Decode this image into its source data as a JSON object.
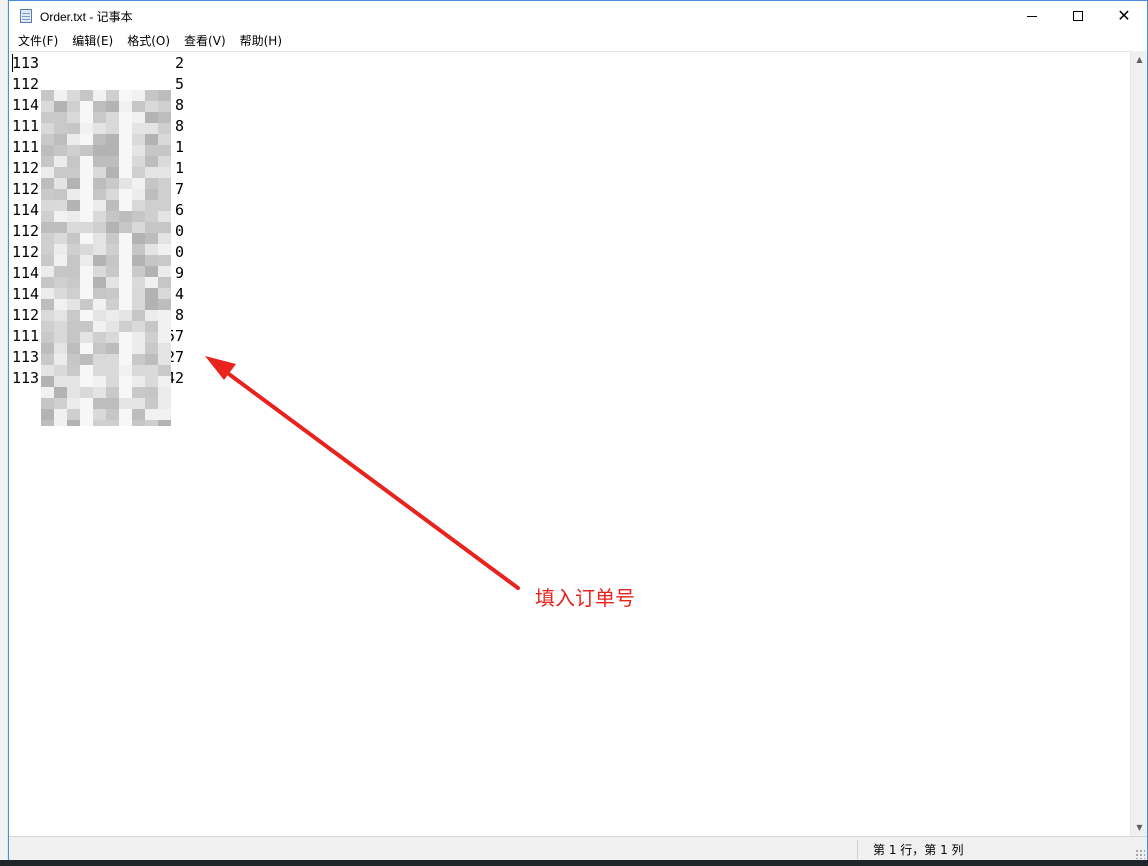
{
  "window": {
    "title": "Order.txt - 记事本",
    "controls": {
      "minimize": "minimize-icon",
      "maximize": "maximize-icon",
      "close": "✕"
    }
  },
  "menu": [
    {
      "label": "文件(F)"
    },
    {
      "label": "编辑(E)"
    },
    {
      "label": "格式(O)"
    },
    {
      "label": "查看(V)"
    },
    {
      "label": "帮助(H)"
    }
  ],
  "editor": {
    "lines": [
      {
        "visible_prefix": "113",
        "visible_suffix": "2"
      },
      {
        "visible_prefix": "112",
        "visible_suffix": "5"
      },
      {
        "visible_prefix": "114",
        "visible_suffix": "8"
      },
      {
        "visible_prefix": "111",
        "visible_suffix": "8"
      },
      {
        "visible_prefix": "111",
        "visible_suffix": "1"
      },
      {
        "visible_prefix": "112",
        "visible_suffix": "1"
      },
      {
        "visible_prefix": "112",
        "visible_suffix": "7"
      },
      {
        "visible_prefix": "114",
        "visible_suffix": "6"
      },
      {
        "visible_prefix": "112",
        "visible_suffix": "0"
      },
      {
        "visible_prefix": "112",
        "visible_suffix": "0"
      },
      {
        "visible_prefix": "114",
        "visible_suffix": "9"
      },
      {
        "visible_prefix": "114-",
        "visible_suffix": "4"
      },
      {
        "visible_prefix": "112",
        "visible_suffix": "8"
      },
      {
        "visible_prefix": "111",
        "visible_suffix": "57"
      },
      {
        "visible_prefix": "113",
        "visible_suffix": "27"
      },
      {
        "visible_prefix": "113-",
        "visible_suffix": "42"
      }
    ]
  },
  "status": {
    "position": "第 1 行，第 1 列"
  },
  "annotation": {
    "text": "填入订单号",
    "color": "#e8231d"
  },
  "icons": {
    "app": "notepad-icon",
    "grip": "resize-grip-icon"
  }
}
